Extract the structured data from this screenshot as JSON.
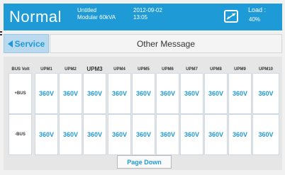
{
  "header": {
    "mode": "Normal",
    "device_line1": "Untitled",
    "device_line2": "Modular 60kVA",
    "date": "2012-09-02",
    "time": "13:05",
    "bypass_icon": "bypass-switch-icon",
    "load_label": "Load :",
    "load_value": "40%"
  },
  "nav": {
    "service_label": "Service",
    "back_icon": "left-triangle-icon",
    "page_title": "Other Message"
  },
  "table": {
    "corner_label": "BUS Volt",
    "columns": [
      "UPM1",
      "UPM2",
      "UPM3",
      "UPM4",
      "UPM5",
      "UPM6",
      "UPM7",
      "UPM8",
      "UPM9",
      "UPM10"
    ],
    "rows": [
      {
        "label": "+BUS",
        "values": [
          "360V",
          "360V",
          "360V",
          "360V",
          "360V",
          "360V",
          "360V",
          "360V",
          "360V",
          "360V"
        ]
      },
      {
        "label": "-BUS",
        "values": [
          "360V",
          "360V",
          "360V",
          "360V",
          "360V",
          "360V",
          "360V",
          "360V",
          "360V",
          "360V"
        ]
      }
    ]
  },
  "footer": {
    "page_down_label": "Page Down"
  },
  "colors": {
    "accent": "#1e9ad6",
    "service_bg": "#b8d9ee"
  }
}
